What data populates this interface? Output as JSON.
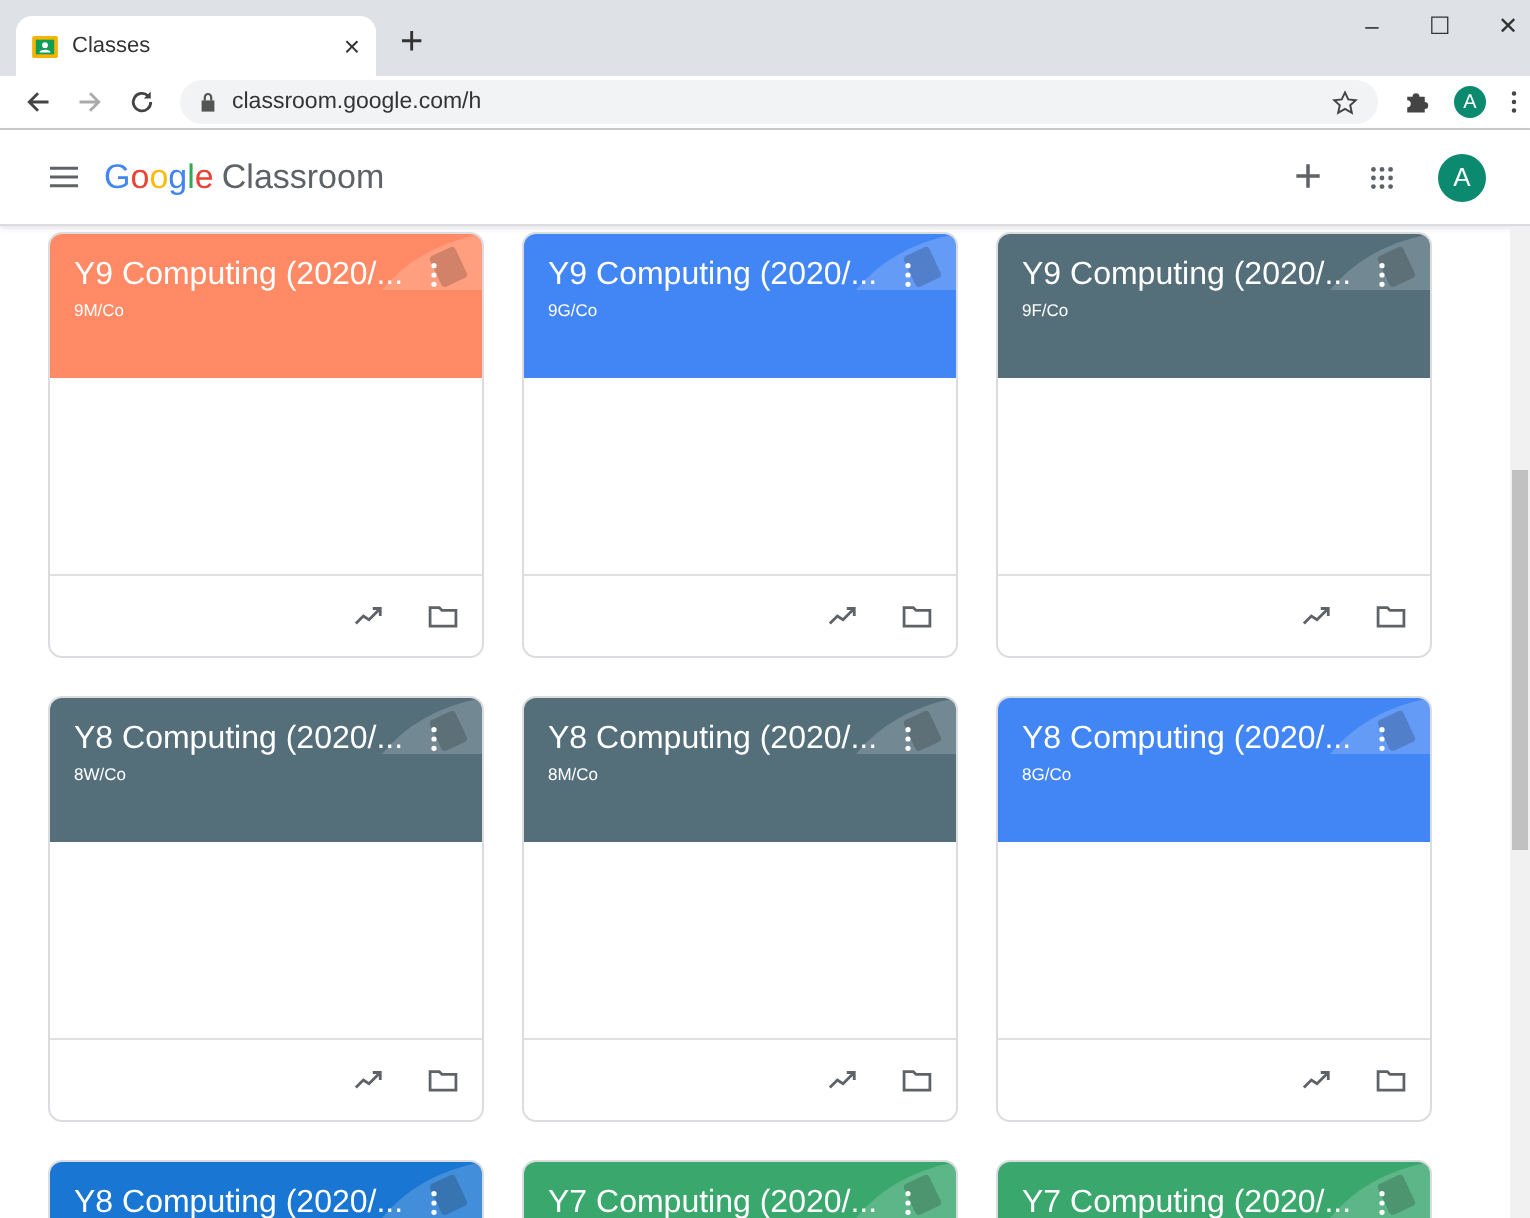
{
  "browser": {
    "tab": {
      "title": "Classes",
      "close": "×"
    },
    "new_tab": "+",
    "window_controls": [
      "–",
      "☐",
      "✕"
    ],
    "address": "classroom.google.com/h",
    "profile": "A"
  },
  "app": {
    "logo": {
      "brand": [
        {
          "letter": "G",
          "color": "#4285f4"
        },
        {
          "letter": "o",
          "color": "#ea4335"
        },
        {
          "letter": "o",
          "color": "#fbbc05"
        },
        {
          "letter": "g",
          "color": "#4285f4"
        },
        {
          "letter": "l",
          "color": "#34a853"
        },
        {
          "letter": "e",
          "color": "#ea4335"
        }
      ],
      "product": "Classroom"
    },
    "add": "+",
    "avatar": "A"
  },
  "classes": [
    {
      "title": "Y9 Computing (2020/...",
      "section": "9M/Co",
      "color": "#ff8a65"
    },
    {
      "title": "Y9 Computing (2020/...",
      "section": "9G/Co",
      "color": "#4285f4"
    },
    {
      "title": "Y9 Computing (2020/...",
      "section": "9F/Co",
      "color": "#546e7a"
    },
    {
      "title": "Y8 Computing (2020/...",
      "section": "8W/Co",
      "color": "#546e7a"
    },
    {
      "title": "Y8 Computing (2020/...",
      "section": "8M/Co",
      "color": "#546e7a"
    },
    {
      "title": "Y8 Computing (2020/...",
      "section": "8G/Co",
      "color": "#4285f4"
    },
    {
      "title": "Y8 Computing (2020/...",
      "color": "#1976d2"
    },
    {
      "title": "Y7 Computing (2020/...",
      "color": "#3aa76d"
    },
    {
      "title": "Y7 Computing (2020/...",
      "color": "#3aa76d"
    }
  ]
}
